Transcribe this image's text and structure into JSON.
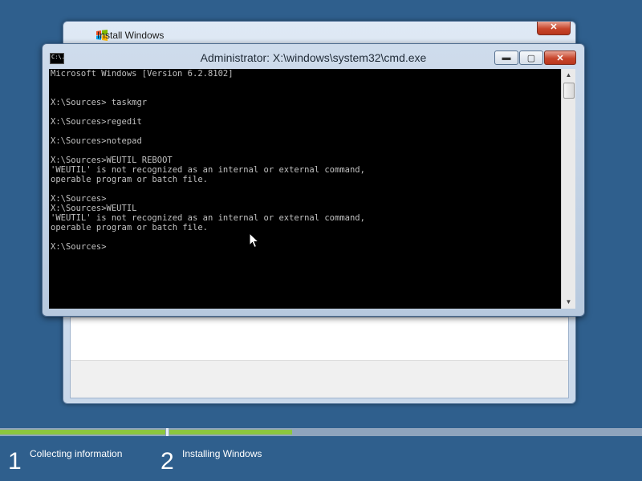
{
  "install_window": {
    "title": "Install Windows",
    "close_label": "✕"
  },
  "cmd_window": {
    "title": "Administrator: X:\\windows\\system32\\cmd.exe",
    "icon_text": "C:\\.",
    "minimize_label": "▬",
    "maximize_label": "▢",
    "close_label": "✕",
    "lines": [
      "Microsoft Windows [Version 6.2.8102]",
      "",
      "",
      "X:\\Sources> taskmgr",
      "",
      "X:\\Sources>regedit",
      "",
      "X:\\Sources>notepad",
      "",
      "X:\\Sources>WEUTIL REBOOT",
      "'WEUTIL' is not recognized as an internal or external command,",
      "operable program or batch file.",
      "",
      "X:\\Sources>",
      "X:\\Sources>WEUTIL",
      "'WEUTIL' is not recognized as an internal or external command,",
      "operable program or batch file.",
      "",
      "X:\\Sources>"
    ]
  },
  "progress": {
    "step1_complete_fraction": 1.0,
    "step2_complete_fraction": 0.26
  },
  "steps": [
    {
      "number": "1",
      "label": "Collecting information"
    },
    {
      "number": "2",
      "label": "Installing Windows"
    }
  ],
  "colors": {
    "desktop_bg": "#2f5f8d",
    "progress_fill": "#8cc63f",
    "console_bg": "#000000",
    "console_text": "#c0c0c0"
  }
}
